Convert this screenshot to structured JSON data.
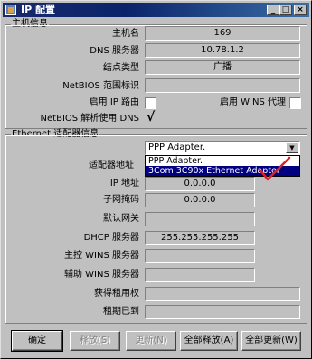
{
  "window": {
    "title": "IP 配置",
    "min_symbol": "_",
    "max_symbol": "□",
    "close_symbol": "×"
  },
  "host_group": {
    "title": "主机信息",
    "host_name_label": "主机名",
    "host_name_value": "169",
    "dns_label": "DNS 服务器",
    "dns_value": "10.78.1.2",
    "node_type_label": "结点类型",
    "node_type_value": "广播",
    "netbios_scope_label": "NetBIOS 范围标识",
    "netbios_scope_value": "",
    "ip_routing_label": "启用 IP 路由",
    "ip_routing_checked": false,
    "wins_proxy_label": "启用 WINS 代理",
    "wins_proxy_checked": false,
    "netbios_dns_label": "NetBIOS 解析使用 DNS",
    "netbios_dns_checked": true,
    "check_glyph": "√"
  },
  "adapter_group": {
    "title": "Ethernet 适配器信息",
    "adapter_selected": "PPP Adapter.",
    "adapter_options": [
      "PPP Adapter.",
      "3Com 3C90x Ethernet Adapter"
    ],
    "adapter_highlight_index": 1,
    "adapter_address_label": "适配器地址",
    "ip_label": "IP 地址",
    "ip_value": "0.0.0.0",
    "subnet_label": "子网掩码",
    "subnet_value": "0.0.0.0",
    "gateway_label": "默认网关",
    "gateway_value": "",
    "dhcp_label": "DHCP 服务器",
    "dhcp_value": "255.255.255.255",
    "primary_wins_label": "主控 WINS 服务器",
    "primary_wins_value": "",
    "secondary_wins_label": "辅助 WINS 服务器",
    "secondary_wins_value": "",
    "lease_obtained_label": "获得租用权",
    "lease_obtained_value": "",
    "lease_expires_label": "租期已到",
    "lease_expires_value": ""
  },
  "buttons": {
    "ok": "确定",
    "release": "释放(S)",
    "renew": "更新(N)",
    "release_all": "全部释放(A)",
    "renew_all": "全部更新(W)"
  },
  "colors": {
    "annotation_checkmark": "#e02020",
    "selection": "#000080",
    "window_face": "#c0c0c0"
  }
}
